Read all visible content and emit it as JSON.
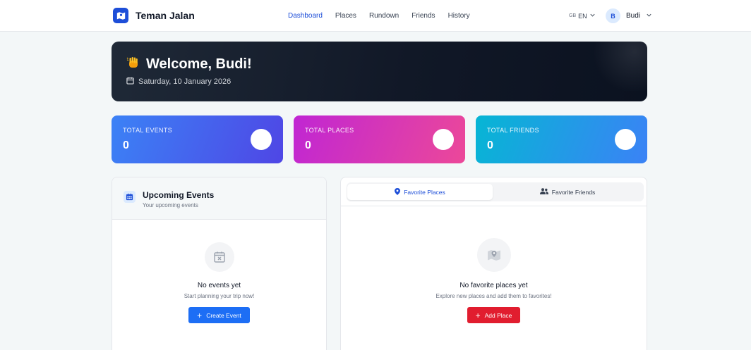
{
  "nav": {
    "brand": "Teman Jalan",
    "links": [
      "Dashboard",
      "Places",
      "Rundown",
      "Friends",
      "History"
    ],
    "active": "Dashboard",
    "lang_flag": "GB",
    "lang": "EN",
    "user_initial": "B",
    "user_name": "Budi"
  },
  "hero": {
    "title": "Welcome, Budi!",
    "date": "Saturday, 10 January 2026"
  },
  "stats": [
    {
      "label": "TOTAL EVENTS",
      "value": "0"
    },
    {
      "label": "TOTAL PLACES",
      "value": "0"
    },
    {
      "label": "TOTAL FRIENDS",
      "value": "0"
    }
  ],
  "upcoming": {
    "title": "Upcoming Events",
    "subtitle": "Your upcoming events",
    "empty_title": "No events yet",
    "empty_sub": "Start planning your trip now!",
    "button": "Create Event"
  },
  "favorites": {
    "tabs": [
      "Favorite Places",
      "Favorite Friends"
    ],
    "active_tab": "Favorite Places",
    "empty_title": "No favorite places yet",
    "empty_sub": "Explore new places and add them to favorites!",
    "button": "Add Place"
  },
  "colors": {
    "primary": "#1d4ed8",
    "add_button": "#e11d2f"
  },
  "icons": {
    "brand": "map-icon",
    "hero": "waving-hand-icon",
    "date": "calendar-icon",
    "upcoming": "calendar-icon",
    "empty_events": "calendar-x-icon",
    "empty_places": "map-icon",
    "tab_places": "map-pin-icon",
    "tab_friends": "users-icon"
  }
}
